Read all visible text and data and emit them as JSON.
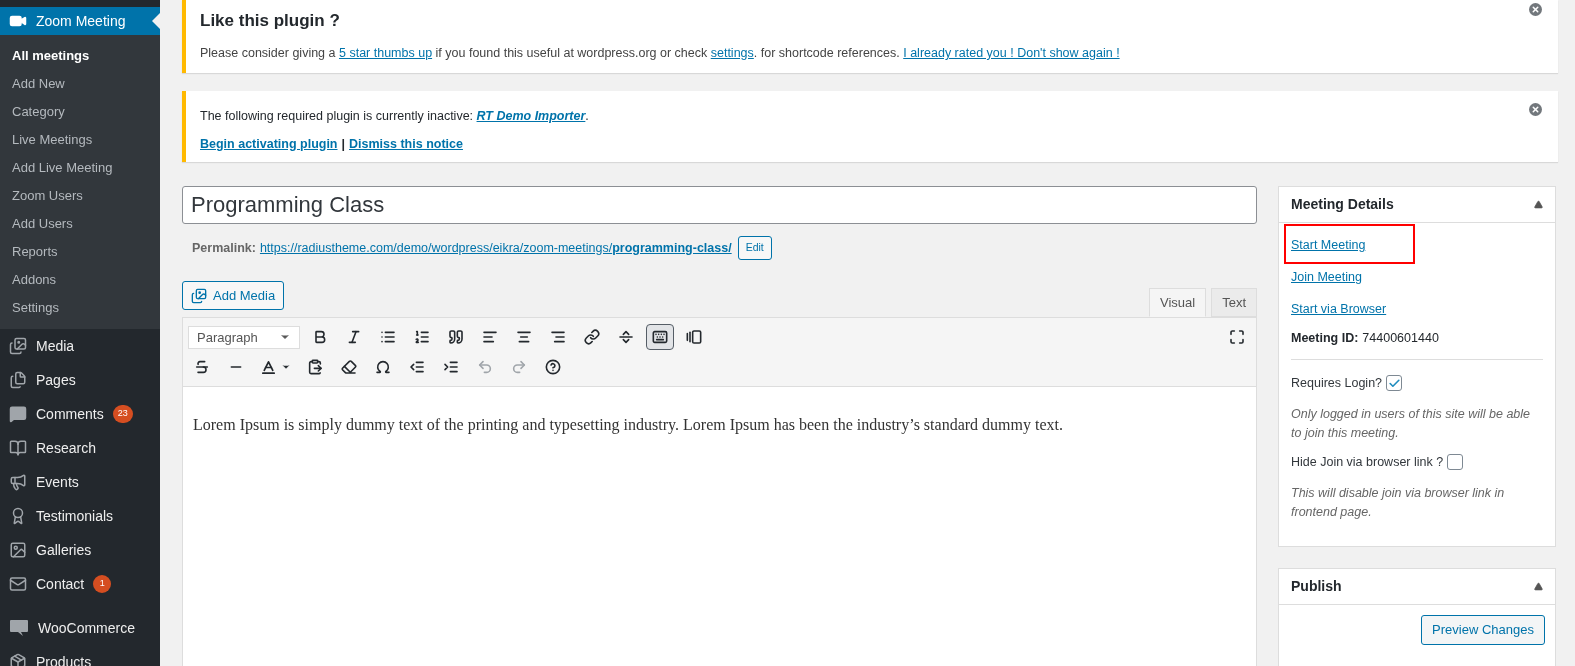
{
  "sidebar": {
    "items": [
      {
        "label": "Zoom Meeting",
        "selected": true,
        "children": [
          {
            "label": "All meetings",
            "selected": true
          },
          {
            "label": "Add New",
            "selected": false
          },
          {
            "label": "Category",
            "selected": false
          },
          {
            "label": "Live Meetings",
            "selected": false
          },
          {
            "label": "Add Live Meeting",
            "selected": false
          },
          {
            "label": "Zoom Users",
            "selected": false
          },
          {
            "label": "Add Users",
            "selected": false
          },
          {
            "label": "Reports",
            "selected": false
          },
          {
            "label": "Addons",
            "selected": false
          },
          {
            "label": "Settings",
            "selected": false
          }
        ]
      },
      {
        "label": "Media",
        "selected": false
      },
      {
        "label": "Pages",
        "selected": false
      },
      {
        "label": "Comments",
        "selected": false,
        "badge": "23"
      },
      {
        "label": "Research",
        "selected": false
      },
      {
        "label": "Events",
        "selected": false
      },
      {
        "label": "Testimonials",
        "selected": false
      },
      {
        "label": "Galleries",
        "selected": false
      },
      {
        "label": "Contact",
        "selected": false,
        "badge": "1"
      },
      {
        "label": "WooCommerce",
        "selected": false
      },
      {
        "label": "Products",
        "selected": false
      }
    ]
  },
  "notices": [
    {
      "title": "Like this plugin ?",
      "parts": [
        {
          "text": "Please consider giving a ",
          "link": false
        },
        {
          "text": "5 star thumbs up",
          "link": true
        },
        {
          "text": " if you found this useful at wordpress.org or check ",
          "link": false
        },
        {
          "text": "settings",
          "link": true
        },
        {
          "text": ". for shortcode references. ",
          "link": false
        },
        {
          "text": "I already rated you ! Don't show again !",
          "link": true
        }
      ]
    },
    {
      "text": "The following required plugin is currently inactive: ",
      "plugin": "RT Demo Importer",
      "after": ".",
      "actions": [
        "Begin activating plugin",
        "Dismiss this notice"
      ],
      "separator": "|"
    }
  ],
  "post": {
    "title": "Programming Class",
    "permalink_label": "Permalink:",
    "permalink_base": "https://radiustheme.com/demo/wordpress/eikra/zoom-meetings/",
    "permalink_slug": "programming-class/",
    "edit_button": "Edit"
  },
  "editor": {
    "add_media": "Add Media",
    "tabs": [
      {
        "label": "Visual",
        "selected": true
      },
      {
        "label": "Text",
        "selected": false
      }
    ],
    "format": "Paragraph",
    "toolbar_toggle_pressed": true,
    "undo_disabled": true,
    "redo_disabled": true,
    "content": "Lorem Ipsum is simply dummy text of the printing and typesetting industry. Lorem Ipsum has been the industry’s standard dummy text."
  },
  "meeting_details": {
    "title": "Meeting Details",
    "expanded": true,
    "links": [
      {
        "label": "Start Meeting",
        "highlighted": true
      },
      {
        "label": "Join Meeting",
        "highlighted": false
      },
      {
        "label": "Start via Browser",
        "highlighted": false
      }
    ],
    "meeting_id_label": "Meeting ID:",
    "meeting_id": "74400601440",
    "options": [
      {
        "label": "Requires Login?",
        "checked": true,
        "note": "Only logged in users of this site will be able to join this meeting."
      },
      {
        "label": "Hide Join via browser link ?",
        "checked": false,
        "note": "This will disable join via browser link in frontend page."
      }
    ]
  },
  "publish": {
    "title": "Publish",
    "expanded": true,
    "preview_button": "Preview Changes"
  }
}
